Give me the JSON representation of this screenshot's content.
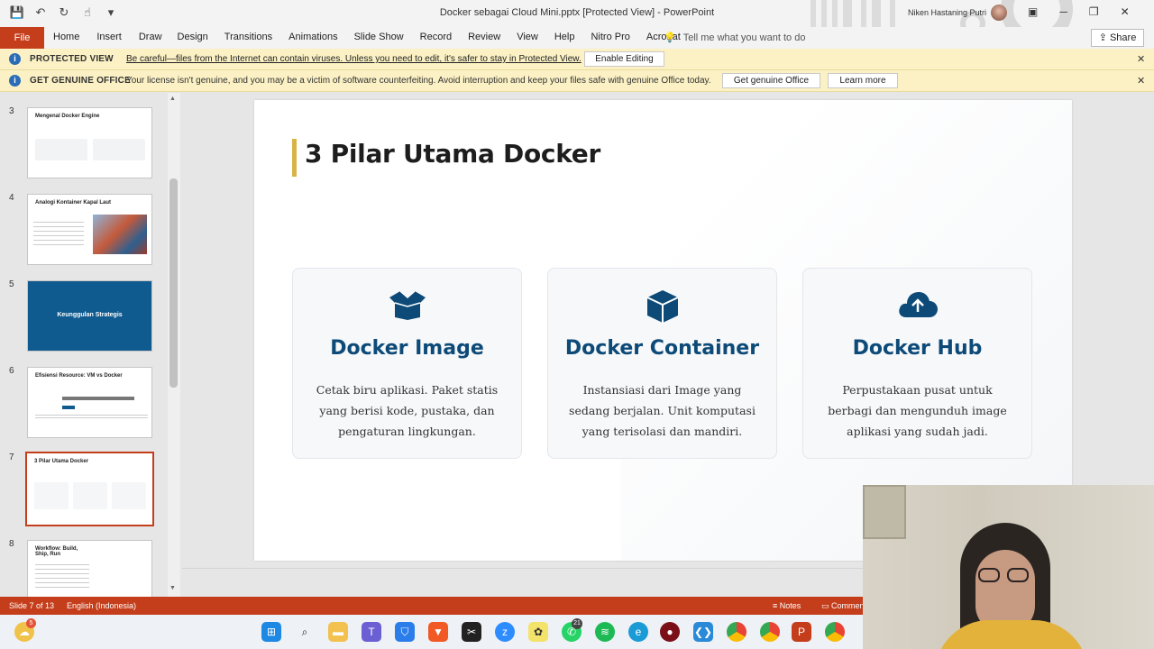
{
  "window": {
    "title": "Docker sebagai Cloud Mini.pptx  [Protected View]  -  PowerPoint",
    "user_name": "Niken Hastaning Putri"
  },
  "quick_access": [
    "save-icon",
    "undo-icon",
    "redo-icon",
    "touch-mode-icon",
    "customize-icon"
  ],
  "ribbon": {
    "file": "File",
    "tabs": [
      "Home",
      "Insert",
      "Draw",
      "Design",
      "Transitions",
      "Animations",
      "Slide Show",
      "Record",
      "Review",
      "View",
      "Help",
      "Nitro Pro",
      "Acrobat"
    ],
    "tell_me": "Tell me what you want to do",
    "share": "Share"
  },
  "protected_view": {
    "label": "PROTECTED VIEW",
    "message": "Be careful—files from the Internet can contain viruses. Unless you need to edit, it's safer to stay in Protected View.",
    "button": "Enable Editing"
  },
  "genuine_office": {
    "label": "GET GENUINE OFFICE",
    "message": "Your license isn't genuine, and you may be a victim of software counterfeiting. Avoid interruption and keep your files safe with genuine Office today.",
    "button1": "Get genuine Office",
    "button2": "Learn more"
  },
  "thumbnails": [
    {
      "num": "3",
      "title": "Mengenal Docker Engine"
    },
    {
      "num": "4",
      "title": "Analogi Kontainer Kapal Laut"
    },
    {
      "num": "5",
      "title": "Keunggulan Strategis"
    },
    {
      "num": "6",
      "title": "Efisiensi Resource: VM vs Docker"
    },
    {
      "num": "7",
      "title": "3 Pilar Utama Docker"
    },
    {
      "num": "8",
      "title": "Workflow: Build, Ship, Run"
    }
  ],
  "slide": {
    "title": "3 Pilar Utama Docker",
    "accent_color": "#d7b446",
    "title_color": "#0d4a78",
    "cards": [
      {
        "icon": "box-open-icon",
        "title": "Docker Image",
        "desc": "Cetak biru aplikasi. Paket statis yang berisi kode, pustaka, dan pengaturan lingkungan."
      },
      {
        "icon": "cube-icon",
        "title": "Docker Container",
        "desc": "Instansiasi dari Image yang sedang berjalan. Unit komputasi yang terisolasi dan mandiri."
      },
      {
        "icon": "cloud-upload-icon",
        "title": "Docker Hub",
        "desc": "Perpustakaan pusat untuk berbagi dan mengunduh image aplikasi yang sudah jadi."
      }
    ]
  },
  "status": {
    "slide_info": "Slide 7 of 13",
    "language": "English (Indonesia)",
    "notes": "Notes",
    "comments": "Comments"
  },
  "taskbar": {
    "whatsapp_badge": "21",
    "weather_badge": "5"
  }
}
